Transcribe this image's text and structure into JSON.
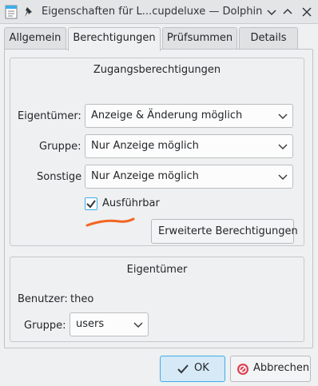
{
  "window": {
    "title": "Eigenschaften für L...cupdeluxe — Dolphin"
  },
  "tabs": [
    {
      "label": "Allgemein",
      "active": false
    },
    {
      "label": "Berechtigungen",
      "active": true
    },
    {
      "label": "Prüfsummen",
      "active": false
    },
    {
      "label": "Details",
      "active": false
    }
  ],
  "access": {
    "title": "Zugangsberechtigungen",
    "owner_label": "Eigentümer:",
    "owner_value": "Anzeige & Änderung möglich",
    "group_label": "Gruppe:",
    "group_value": "Nur Anzeige möglich",
    "others_label": "Sonstige",
    "others_value": "Nur Anzeige möglich",
    "executable_label": "Ausführbar",
    "executable_checked": true,
    "advanced_button": "Erweiterte Berechtigungen"
  },
  "ownership": {
    "title": "Eigentümer",
    "user_label": "Benutzer:",
    "user_value": "theo",
    "group_label": "Gruppe:",
    "group_value": "users"
  },
  "buttons": {
    "ok": "OK",
    "cancel": "Abbrechen"
  },
  "colors": {
    "accent": "#3daee9",
    "annotation": "#f26522"
  }
}
